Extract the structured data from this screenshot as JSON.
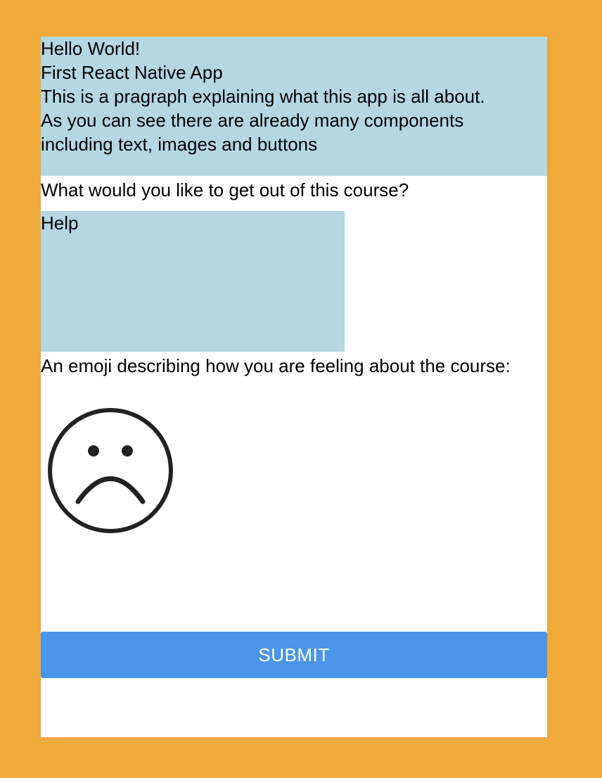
{
  "intro": {
    "title": "Hello World!",
    "subtitle": "First React Native App",
    "paragraph_line_1": "This is a pragraph explaining what this app is all about.",
    "paragraph_line_2": "As you can see there are already many components",
    "paragraph_line_3": "including text, images and buttons"
  },
  "question": {
    "label": "What would you like to get out of this course?",
    "value": "Help"
  },
  "emoji": {
    "label": "An emoji describing how you are feeling about the course:",
    "icon": "sad-face-icon"
  },
  "submit": {
    "label": "SUBMIT"
  },
  "colors": {
    "background": "#F0A93B",
    "panel": "#FFFFFF",
    "highlight": "#B4D7E3",
    "button": "#4A95E9",
    "button_text": "#FFFFFF"
  }
}
